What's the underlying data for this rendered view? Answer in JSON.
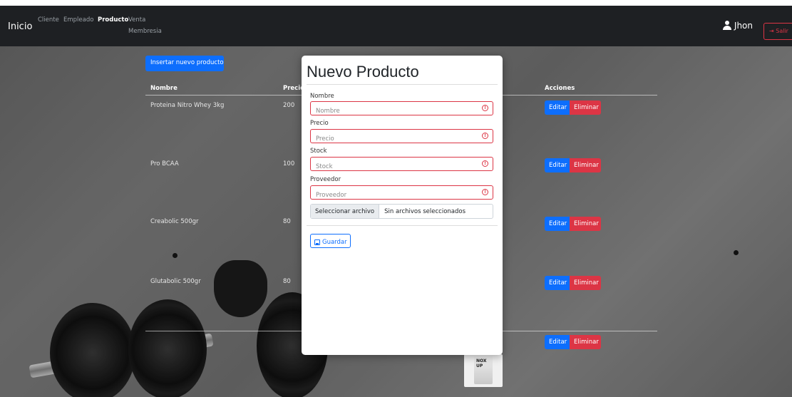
{
  "navbar": {
    "brand": "Inicio",
    "links": [
      "Cliente",
      "Empleado",
      "Producto",
      "Venta"
    ],
    "sub_link": "Membresia",
    "active_link": "Producto",
    "user": "Jhon",
    "logout": "Salir"
  },
  "page": {
    "insert_button": "Insertar nuevo producto",
    "columns": {
      "nombre": "Nombre",
      "precio": "Precio",
      "acciones": "Acciones"
    },
    "rows": [
      {
        "nombre": "Proteina Nitro Whey 3kg",
        "precio": "200"
      },
      {
        "nombre": "Pro BCAA",
        "precio": "100"
      },
      {
        "nombre": "Creabolic 500gr",
        "precio": "80"
      },
      {
        "nombre": "Glutabolic 500gr",
        "precio": "80"
      },
      {
        "nombre": "",
        "precio": ""
      }
    ],
    "edit_label": "Editar",
    "delete_label": "Eliminar",
    "product_image_text": "NOX UP"
  },
  "modal": {
    "title": "Nuevo Producto",
    "fields": [
      {
        "label": "Nombre",
        "placeholder": "Nombre"
      },
      {
        "label": "Precio",
        "placeholder": "Precio"
      },
      {
        "label": "Stock",
        "placeholder": "Stock"
      },
      {
        "label": "Proveedor",
        "placeholder": "Proveedor"
      }
    ],
    "file_button": "Seleccionar archivo",
    "file_status": "Sin archivos seleccionados",
    "save_label": "Guardar",
    "warn_glyph": "!"
  },
  "colors": {
    "navbar": "#1e2023",
    "primary": "#0d6efd",
    "danger": "#dc3545"
  }
}
